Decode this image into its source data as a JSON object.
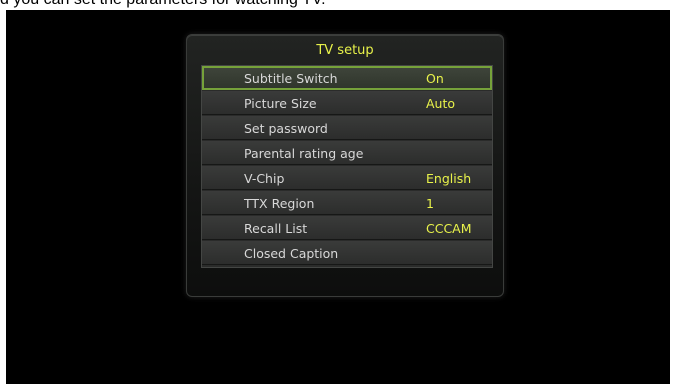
{
  "caption": "d you can set the parameters for watching TV.",
  "panel": {
    "title": "TV setup"
  },
  "menu": {
    "items": [
      {
        "label": "Subtitle Switch",
        "value": "On",
        "selected": true
      },
      {
        "label": "Picture Size",
        "value": "Auto",
        "selected": false
      },
      {
        "label": "Set password",
        "value": "",
        "selected": false
      },
      {
        "label": "Parental rating age",
        "value": "",
        "selected": false
      },
      {
        "label": "V-Chip",
        "value": "English",
        "selected": false
      },
      {
        "label": "TTX Region",
        "value": "1",
        "selected": false
      },
      {
        "label": "Recall List",
        "value": "CCCAM",
        "selected": false
      },
      {
        "label": "Closed Caption",
        "value": "",
        "selected": false
      }
    ]
  },
  "colors": {
    "accent": "#e8f24a",
    "selection": "#76a23a",
    "background": "#000000"
  }
}
